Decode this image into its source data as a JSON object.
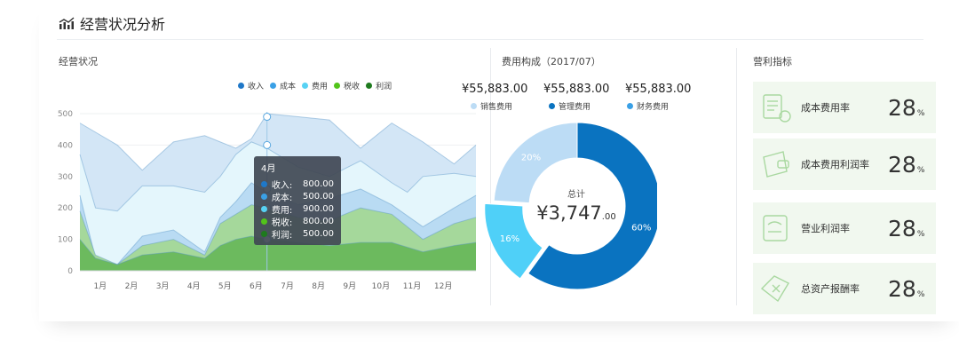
{
  "header": {
    "title": "经营状况分析"
  },
  "business": {
    "title": "经营状况",
    "legend": [
      {
        "label": "收入",
        "color": "#1f78c8"
      },
      {
        "label": "成本",
        "color": "#3aa0e6"
      },
      {
        "label": "费用",
        "color": "#57d2f4"
      },
      {
        "label": "税收",
        "color": "#52c41a"
      },
      {
        "label": "利润",
        "color": "#1e7a1e"
      }
    ],
    "tooltip": {
      "title": "4月",
      "rows": [
        {
          "label": "收入:",
          "value": "800.00",
          "color": "#1f78c8"
        },
        {
          "label": "成本:",
          "value": "500.00",
          "color": "#3aa0e6"
        },
        {
          "label": "费用:",
          "value": "900.00",
          "color": "#57d2f4"
        },
        {
          "label": "税收:",
          "value": "800.00",
          "color": "#52c41a"
        },
        {
          "label": "利润:",
          "value": "500.00",
          "color": "#1e7a1e"
        }
      ]
    }
  },
  "chart_data": {
    "type": "area",
    "categories": [
      "1月",
      "2月",
      "3月",
      "4月",
      "5月",
      "6月",
      "7月",
      "8月",
      "9月",
      "10月",
      "11月",
      "12月"
    ],
    "yticks": [
      0,
      100,
      200,
      300,
      400,
      500
    ],
    "ylim": [
      0,
      500
    ],
    "series": [
      {
        "name": "收入",
        "color": "#d3e6f6",
        "x": [
          0.0,
          1.2,
          2.0,
          3.0,
          4.0,
          5.0,
          5.5,
          6.0,
          7.0,
          8.0,
          9.0,
          10.0,
          11.0,
          12.0,
          12.7
        ],
        "values": [
          470,
          400,
          320,
          410,
          430,
          390,
          420,
          500,
          490,
          480,
          390,
          470,
          410,
          340,
          400
        ]
      },
      {
        "name": "费用",
        "color": "#e4f6fc",
        "x": [
          0.0,
          0.5,
          1.2,
          2.0,
          3.0,
          4.0,
          4.5,
          5.0,
          5.5,
          6.0,
          7.0,
          8.0,
          9.0,
          10.0,
          10.5,
          11.0,
          12.0,
          12.7
        ],
        "values": [
          370,
          200,
          190,
          270,
          270,
          250,
          300,
          370,
          410,
          390,
          330,
          300,
          350,
          280,
          250,
          300,
          310,
          300
        ]
      },
      {
        "name": "成本",
        "color": "#b9dbf3",
        "x": [
          0.0,
          0.5,
          1.2,
          2.0,
          3.0,
          4.0,
          4.5,
          5.0,
          5.5,
          6.0,
          7.0,
          8.0,
          9.0,
          10.0,
          11.0,
          12.0,
          12.7
        ],
        "values": [
          240,
          40,
          20,
          110,
          130,
          60,
          170,
          220,
          280,
          250,
          210,
          230,
          260,
          210,
          140,
          200,
          240
        ]
      },
      {
        "name": "税收",
        "color": "#a5d89b",
        "x": [
          0.0,
          0.5,
          1.2,
          2.0,
          3.0,
          4.0,
          4.5,
          5.0,
          5.5,
          6.0,
          7.0,
          8.0,
          9.0,
          10.0,
          11.0,
          12.0,
          12.7
        ],
        "values": [
          190,
          50,
          20,
          80,
          100,
          50,
          150,
          180,
          210,
          200,
          170,
          160,
          200,
          180,
          100,
          150,
          170
        ]
      },
      {
        "name": "利润",
        "color": "#6cba5e",
        "x": [
          0.0,
          0.5,
          1.2,
          2.0,
          3.0,
          4.0,
          4.5,
          5.0,
          5.5,
          6.0,
          7.0,
          8.0,
          9.0,
          10.0,
          11.0,
          12.0,
          12.7
        ],
        "values": [
          100,
          40,
          20,
          50,
          60,
          40,
          80,
          100,
          110,
          100,
          90,
          80,
          90,
          90,
          60,
          80,
          90
        ]
      }
    ]
  },
  "cost": {
    "title": "费用构成（2017/07）",
    "amounts": [
      "¥55,883.00",
      "¥55,883.00",
      "¥55,883.00"
    ],
    "legend": [
      {
        "label": "销售费用",
        "color": "#bcdcf5"
      },
      {
        "label": "管理费用",
        "color": "#0a73c0"
      },
      {
        "label": "财务费用",
        "color": "#3aa0e6"
      }
    ],
    "total_label": "总计",
    "total_currency": "¥",
    "total_value": "3,747",
    "total_decimals": ".00",
    "slices": [
      {
        "name": "管理费用",
        "percent": 60,
        "label": "60%",
        "color": "#0a73c0"
      },
      {
        "name": "财务费用",
        "percent": 16,
        "label": "16%",
        "color": "#4fd0f8"
      },
      {
        "name": "销售费用",
        "percent": 20,
        "label": "20%",
        "color": "#bcdcf5"
      }
    ]
  },
  "profit": {
    "title": "营利指标",
    "items": [
      {
        "label": "成本费用率",
        "value": "28",
        "unit": "%",
        "icon": "receipt-icon"
      },
      {
        "label": "成本费用利润率",
        "value": "28",
        "unit": "%",
        "icon": "wallet-icon"
      },
      {
        "label": "营业利润率",
        "value": "28",
        "unit": "%",
        "icon": "document-icon"
      },
      {
        "label": "总资产报酬率",
        "value": "28",
        "unit": "%",
        "icon": "coupon-icon"
      }
    ]
  }
}
